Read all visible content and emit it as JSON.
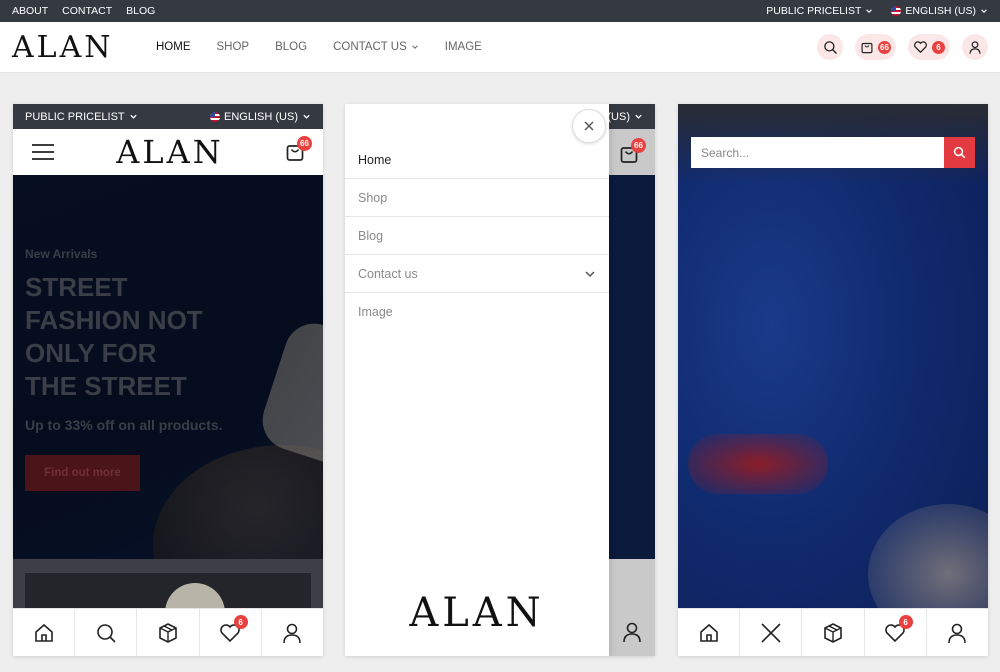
{
  "desktop": {
    "topbar": {
      "links": [
        "ABOUT",
        "CONTACT",
        "BLOG"
      ],
      "pricelist": "PUBLIC PRICELIST",
      "language": "ENGLISH (US)"
    },
    "logo": "ALAN",
    "nav": [
      "HOME",
      "SHOP",
      "BLOG",
      "CONTACT US",
      "IMAGE"
    ],
    "cart_count": "66",
    "wishlist_count": "6"
  },
  "mobile": {
    "pricelist": "PUBLIC PRICELIST",
    "language": "ENGLISH (US)",
    "logo": "ALAN",
    "cart_count": "66",
    "wishlist_count": "6",
    "hero": {
      "kicker": "New Arrivals",
      "title": "STREET FASHION NOT ONLY FOR THE STREET",
      "subtitle": "Up to 33% off on all products.",
      "button": "Find out more"
    },
    "menu": {
      "items": [
        "Home",
        "Shop",
        "Blog",
        "Contact us",
        "Image"
      ],
      "logo": "ALAN"
    },
    "search": {
      "placeholder": "Search..."
    }
  },
  "colors": {
    "accent": "#e8413f",
    "topbar": "#353a42",
    "badge_bg": "#fbe7e8"
  }
}
